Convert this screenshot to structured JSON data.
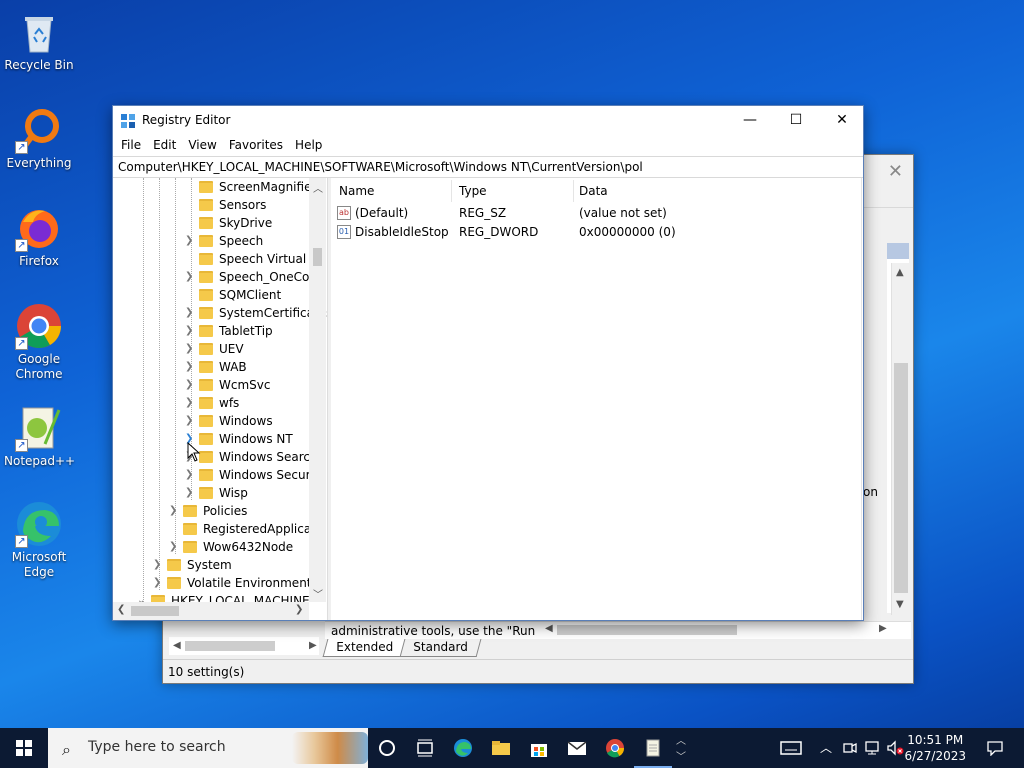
{
  "desktop": {
    "icons": [
      {
        "label": "Recycle Bin"
      },
      {
        "label": "Everything"
      },
      {
        "label": "Firefox"
      },
      {
        "label": "Google Chrome"
      },
      {
        "label": "Notepad++"
      },
      {
        "label": "Microsoft Edge"
      }
    ]
  },
  "background_window": {
    "description_text": "administrative tools, use the \"Run",
    "partial_text": "on",
    "tabs": [
      "Extended",
      "Standard"
    ],
    "status": "10 setting(s)"
  },
  "registry_editor": {
    "title": "Registry Editor",
    "menu": [
      "File",
      "Edit",
      "View",
      "Favorites",
      "Help"
    ],
    "address": "Computer\\HKEY_LOCAL_MACHINE\\SOFTWARE\\Microsoft\\Windows NT\\CurrentVersion\\pol",
    "tree": [
      {
        "label": "ScreenMagnifier",
        "expandable": false
      },
      {
        "label": "Sensors",
        "expandable": false
      },
      {
        "label": "SkyDrive",
        "expandable": false
      },
      {
        "label": "Speech",
        "expandable": true
      },
      {
        "label": "Speech Virtual",
        "expandable": false
      },
      {
        "label": "Speech_OneCore",
        "expandable": true
      },
      {
        "label": "SQMClient",
        "expandable": false
      },
      {
        "label": "SystemCertificates",
        "expandable": true
      },
      {
        "label": "TabletTip",
        "expandable": true
      },
      {
        "label": "UEV",
        "expandable": true
      },
      {
        "label": "WAB",
        "expandable": true
      },
      {
        "label": "WcmSvc",
        "expandable": true
      },
      {
        "label": "wfs",
        "expandable": true
      },
      {
        "label": "Windows",
        "expandable": true
      },
      {
        "label": "Windows NT",
        "expandable": true
      },
      {
        "label": "Windows Search",
        "expandable": true
      },
      {
        "label": "Windows Security",
        "expandable": true
      },
      {
        "label": "Wisp",
        "expandable": true
      },
      {
        "label": "Policies",
        "expandable": true
      },
      {
        "label": "RegisteredApplications",
        "expandable": false
      },
      {
        "label": "Wow6432Node",
        "expandable": true
      },
      {
        "label": "System",
        "expandable": true
      },
      {
        "label": "Volatile Environment",
        "expandable": true
      },
      {
        "label": "HKEY_LOCAL_MACHINE",
        "expandable": true
      }
    ],
    "columns": [
      "Name",
      "Type",
      "Data"
    ],
    "values": [
      {
        "name": "(Default)",
        "type": "REG_SZ",
        "data": "(value not set)",
        "icon": "string-value-icon"
      },
      {
        "name": "DisableIdleStop",
        "type": "REG_DWORD",
        "data": "0x00000000 (0)",
        "icon": "binary-value-icon"
      }
    ]
  },
  "taskbar": {
    "search_placeholder": "Type here to search",
    "time": "10:51 PM",
    "date": "6/27/2023"
  },
  "colors": {
    "desktop_accent": "#0f63d6",
    "taskbar": "#0c1a33",
    "folder": "#f5c94a"
  }
}
